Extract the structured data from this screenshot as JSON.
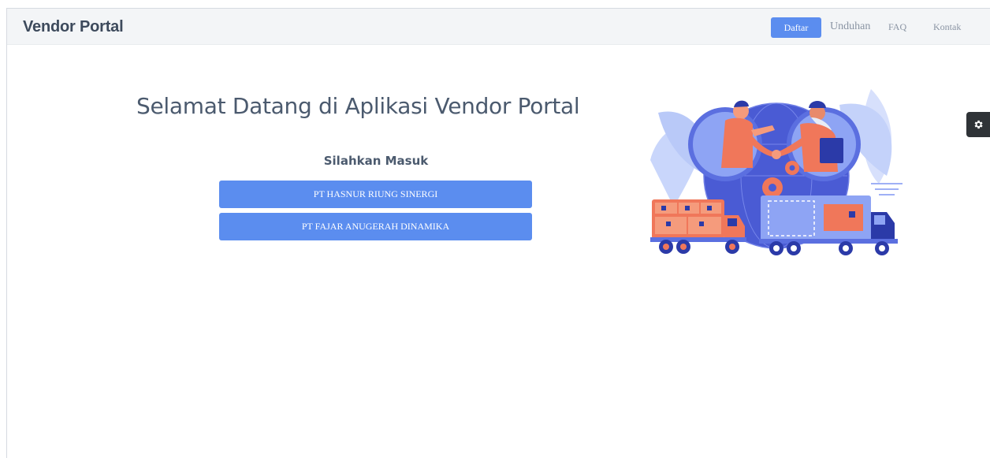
{
  "navbar": {
    "brand": "Vendor Portal",
    "register_label": "Daftar",
    "links": [
      "Unduhan",
      "FAQ",
      "Kontak"
    ]
  },
  "main": {
    "headline": "Selamat Datang di Aplikasi Vendor Portal",
    "subtitle": "Silahkan Masuk",
    "companies": [
      "PT HASNUR RIUNG SINERGI",
      "PT FAJAR ANUGERAH DINAMIKA"
    ]
  },
  "illustration": {
    "icon": "handshake-delivery-trucks-illustration"
  },
  "settings": {
    "icon": "gear-icon"
  },
  "colors": {
    "primary": "#5b8def",
    "navbar_bg": "#f3f5f7",
    "heading": "#4b5a6e",
    "settings_bg": "#2f3337"
  }
}
